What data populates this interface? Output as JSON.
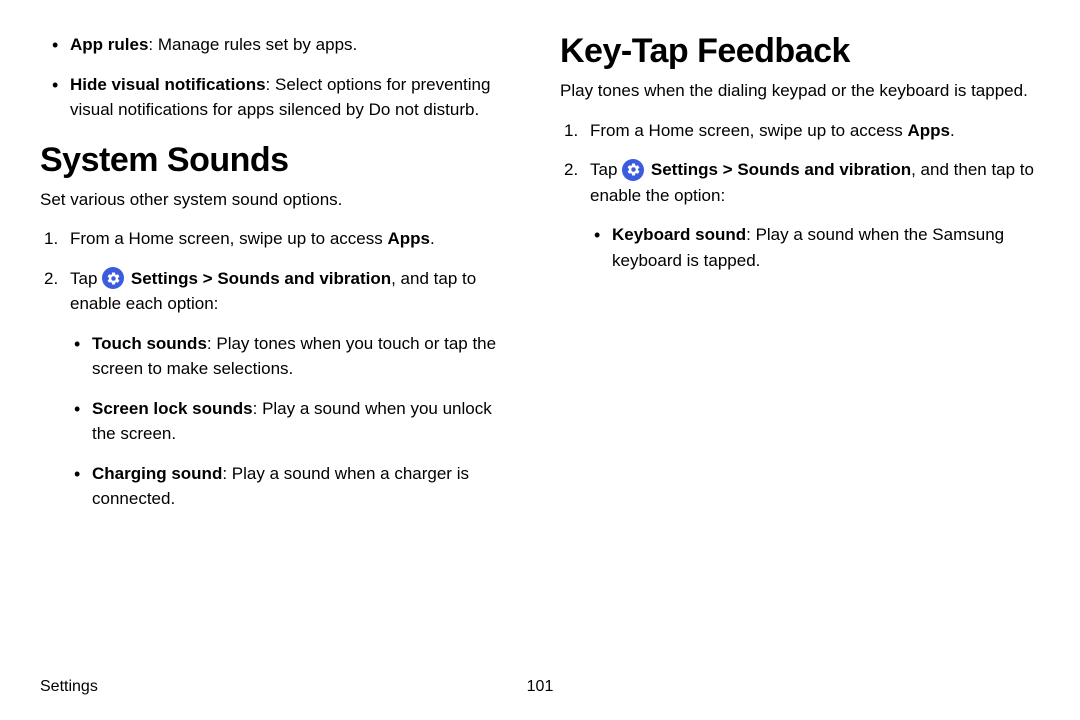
{
  "left": {
    "bullets": [
      {
        "label": "App rules",
        "desc": ": Manage rules set by apps."
      },
      {
        "label": "Hide visual notifications",
        "desc": ": Select options for preventing visual notifications for apps silenced by Do not disturb."
      }
    ],
    "heading": "System Sounds",
    "intro": "Set various other system sound options.",
    "step1_pre": "From a Home screen, swipe up to access ",
    "step1_bold": "Apps",
    "step1_post": ".",
    "step2_pre": "Tap ",
    "step2_settings": "Settings",
    "step2_sep": " > ",
    "step2_path": "Sounds and vibration",
    "step2_post": ", and tap to enable each option:",
    "options": [
      {
        "label": "Touch sounds",
        "desc": ": Play tones when you touch or tap the screen to make selections."
      },
      {
        "label": "Screen lock sounds",
        "desc": ": Play a sound when you unlock the screen."
      },
      {
        "label": "Charging sound",
        "desc": ": Play a sound when a charger is connected."
      }
    ]
  },
  "right": {
    "heading": "Key-Tap Feedback",
    "intro": "Play tones when the dialing keypad or the keyboard is tapped.",
    "step1_pre": "From a Home screen, swipe up to access ",
    "step1_bold": "Apps",
    "step1_post": ".",
    "step2_pre": "Tap ",
    "step2_settings": "Settings",
    "step2_sep": " > ",
    "step2_path": "Sounds and vibration",
    "step2_post": ", and then tap to enable the option:",
    "options": [
      {
        "label": "Keyboard sound",
        "desc": ": Play a sound when the Samsung keyboard is tapped."
      }
    ]
  },
  "footer": {
    "section": "Settings",
    "page": "101"
  }
}
